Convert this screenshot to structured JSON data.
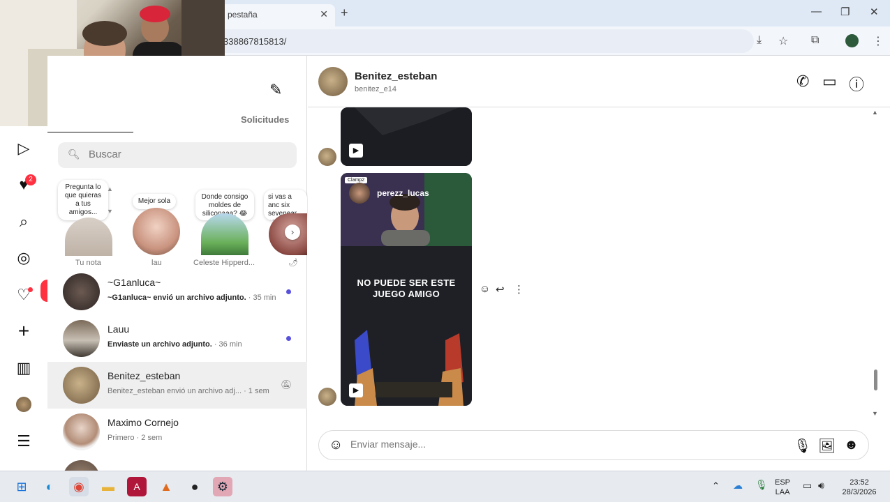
{
  "browser": {
    "tab_title": "pestaña",
    "url": "338867815813/"
  },
  "nav": {
    "notifications_badge": "2",
    "activity_likes": "1",
    "activity_follows": "1"
  },
  "inbox": {
    "requests_label": "Solicitudes",
    "search_placeholder": "Buscar",
    "notes": [
      {
        "text": "Pregunta lo que quieras a tus amigos...",
        "name": "Tu nota"
      },
      {
        "text": "Mejor sola",
        "name": "lau"
      },
      {
        "text": "Donde consigo moldes de siliconaaa? 😂",
        "name": "Celeste Hipperd..."
      },
      {
        "text": "si vas a anc six sevenear con otras, r",
        "name": ""
      }
    ],
    "conversations": [
      {
        "name": "~G1anluca~",
        "last": "~G1anluca~ envió un archivo adjunto.",
        "time": " · 35 min",
        "unread": true
      },
      {
        "name": "Lauu",
        "last": "Enviaste un archivo adjunto.",
        "time": " · 36 min",
        "unread": true
      },
      {
        "name": "Benitez_esteban",
        "last": "Benitez_esteban envió un archivo adj...",
        "time": " · 1 sem",
        "unread": false
      },
      {
        "name": "Maximo Cornejo",
        "last": "Primero",
        "time": " · 2 sem",
        "unread": false
      }
    ]
  },
  "chat": {
    "name": "Benitez_esteban",
    "username": "benitez_e14",
    "reel_source": "Clamp2",
    "reel_author": "perezz_lucas",
    "reel_caption": "NO PUEDE SER ESTE JUEGO AMIGO",
    "composer_placeholder": "Enviar mensaje..."
  },
  "taskbar": {
    "language": "ESP",
    "layout": "LAA",
    "time": "23:52",
    "date": "28/3/2026"
  }
}
